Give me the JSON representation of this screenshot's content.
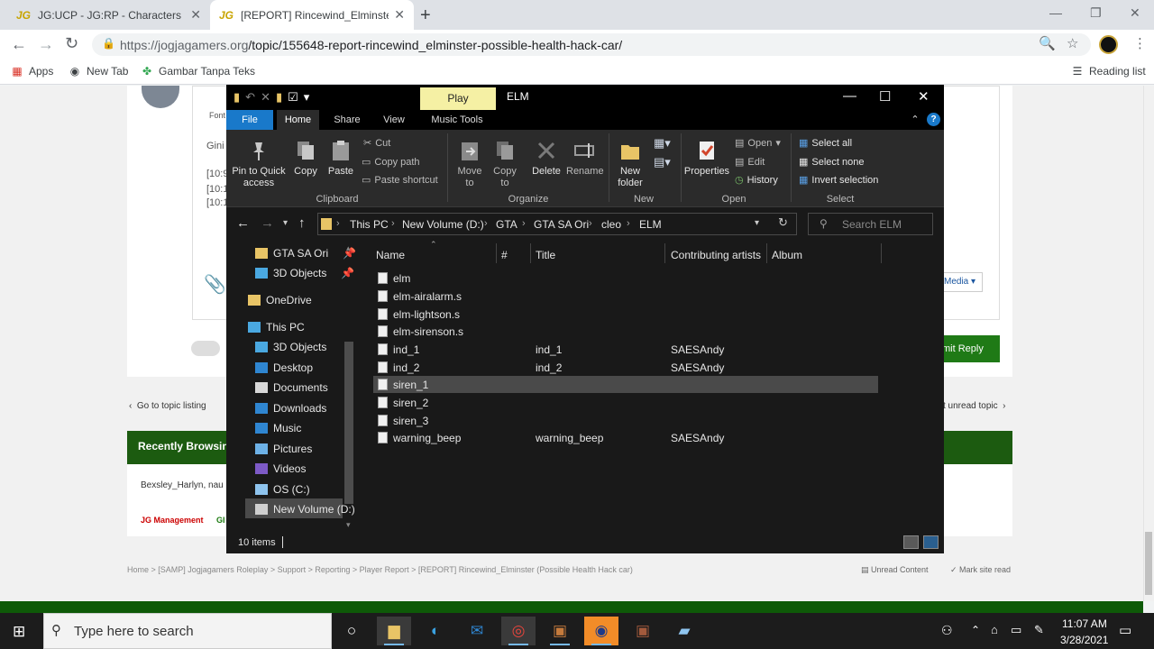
{
  "browser": {
    "tabs": [
      {
        "title": "JG:UCP - JG:RP - Characters",
        "favicon": "JG"
      },
      {
        "title": "[REPORT] Rincewind_Elminster (P",
        "favicon": "JG"
      }
    ],
    "url_host": "https://jogjagamers.org",
    "url_path": "/topic/155648-report-rincewind_elminster-possible-health-hack-car/",
    "bookmarks": [
      "Apps",
      "New Tab",
      "Gambar Tanpa Teks"
    ],
    "reading_list": "Reading list"
  },
  "page": {
    "post_lines": [
      "Gini",
      "[10:9",
      "[10:1",
      "[10:1"
    ],
    "font_label": "Font",
    "media_label": "Media",
    "submit_label": "mit Reply",
    "go_to_listing": "Go to topic listing",
    "next_unread": "t unread topic",
    "recently_browsing": "Recently Browsin",
    "users": "Bexsley_Harlyn, nau",
    "management": "JG Management",
    "management_extra": "GI",
    "breadcrumb": "Home > [SAMP] Jogjagamers Roleplay > Support > Reporting > Player Report > [REPORT] Rincewind_Elminster (Possible Health Hack car)",
    "unread_content": "Unread Content",
    "mark_site_read": "Mark site read"
  },
  "explorer": {
    "title": "ELM",
    "context_tab": "Play",
    "ribbon_tabs": [
      "File",
      "Home",
      "Share",
      "View",
      "Music Tools"
    ],
    "clipboard": {
      "pin": "Pin to Quick access",
      "copy": "Copy",
      "paste": "Paste",
      "cut": "Cut",
      "copy_path": "Copy path",
      "paste_shortcut": "Paste shortcut",
      "group": "Clipboard"
    },
    "organize": {
      "move_to": "Move to",
      "copy_to": "Copy to",
      "delete": "Delete",
      "rename": "Rename",
      "group": "Organize"
    },
    "new": {
      "new_folder": "New folder",
      "group": "New"
    },
    "open": {
      "properties": "Properties",
      "open": "Open",
      "edit": "Edit",
      "history": "History",
      "group": "Open"
    },
    "select": {
      "select_all": "Select all",
      "select_none": "Select none",
      "invert": "Invert selection",
      "group": "Select"
    },
    "breadcrumb": [
      "This PC",
      "New Volume (D:)",
      "GTA",
      "GTA SA Ori",
      "cleo",
      "ELM"
    ],
    "search_placeholder": "Search ELM",
    "nav": [
      {
        "label": "GTA SA Ori",
        "icon": "folder-icon",
        "pinned": true
      },
      {
        "label": "3D Objects",
        "icon": "3d-objects-icon",
        "pinned": true
      },
      {
        "label": "OneDrive",
        "icon": "folder-icon"
      },
      {
        "label": "This PC",
        "icon": "pc-icon"
      },
      {
        "label": "3D Objects",
        "icon": "3d-objects-icon"
      },
      {
        "label": "Desktop",
        "icon": "desktop-icon"
      },
      {
        "label": "Documents",
        "icon": "documents-icon"
      },
      {
        "label": "Downloads",
        "icon": "downloads-icon"
      },
      {
        "label": "Music",
        "icon": "music-icon"
      },
      {
        "label": "Pictures",
        "icon": "pictures-icon"
      },
      {
        "label": "Videos",
        "icon": "videos-icon"
      },
      {
        "label": "OS (C:)",
        "icon": "drive-icon"
      },
      {
        "label": "New Volume (D:)",
        "icon": "drive-icon"
      }
    ],
    "columns": [
      "Name",
      "#",
      "Title",
      "Contributing artists",
      "Album"
    ],
    "files": [
      {
        "name": "elm",
        "title": "",
        "artist": ""
      },
      {
        "name": "elm-airalarm.s",
        "title": "",
        "artist": ""
      },
      {
        "name": "elm-lightson.s",
        "title": "",
        "artist": ""
      },
      {
        "name": "elm-sirenson.s",
        "title": "",
        "artist": ""
      },
      {
        "name": "ind_1",
        "title": "ind_1",
        "artist": "SAESAndy"
      },
      {
        "name": "ind_2",
        "title": "ind_2",
        "artist": "SAESAndy"
      },
      {
        "name": "siren_1",
        "title": "",
        "artist": ""
      },
      {
        "name": "siren_2",
        "title": "",
        "artist": ""
      },
      {
        "name": "siren_3",
        "title": "",
        "artist": ""
      },
      {
        "name": "warning_beep",
        "title": "warning_beep",
        "artist": "SAESAndy"
      }
    ],
    "status": "10 items"
  },
  "taskbar": {
    "search_placeholder": "Type here to search",
    "time": "11:07 AM",
    "date": "3/28/2021"
  },
  "colors": {
    "accent_blue": "#1979ca",
    "play_tab": "#f5f0a4",
    "site_green": "#1c5b10"
  }
}
